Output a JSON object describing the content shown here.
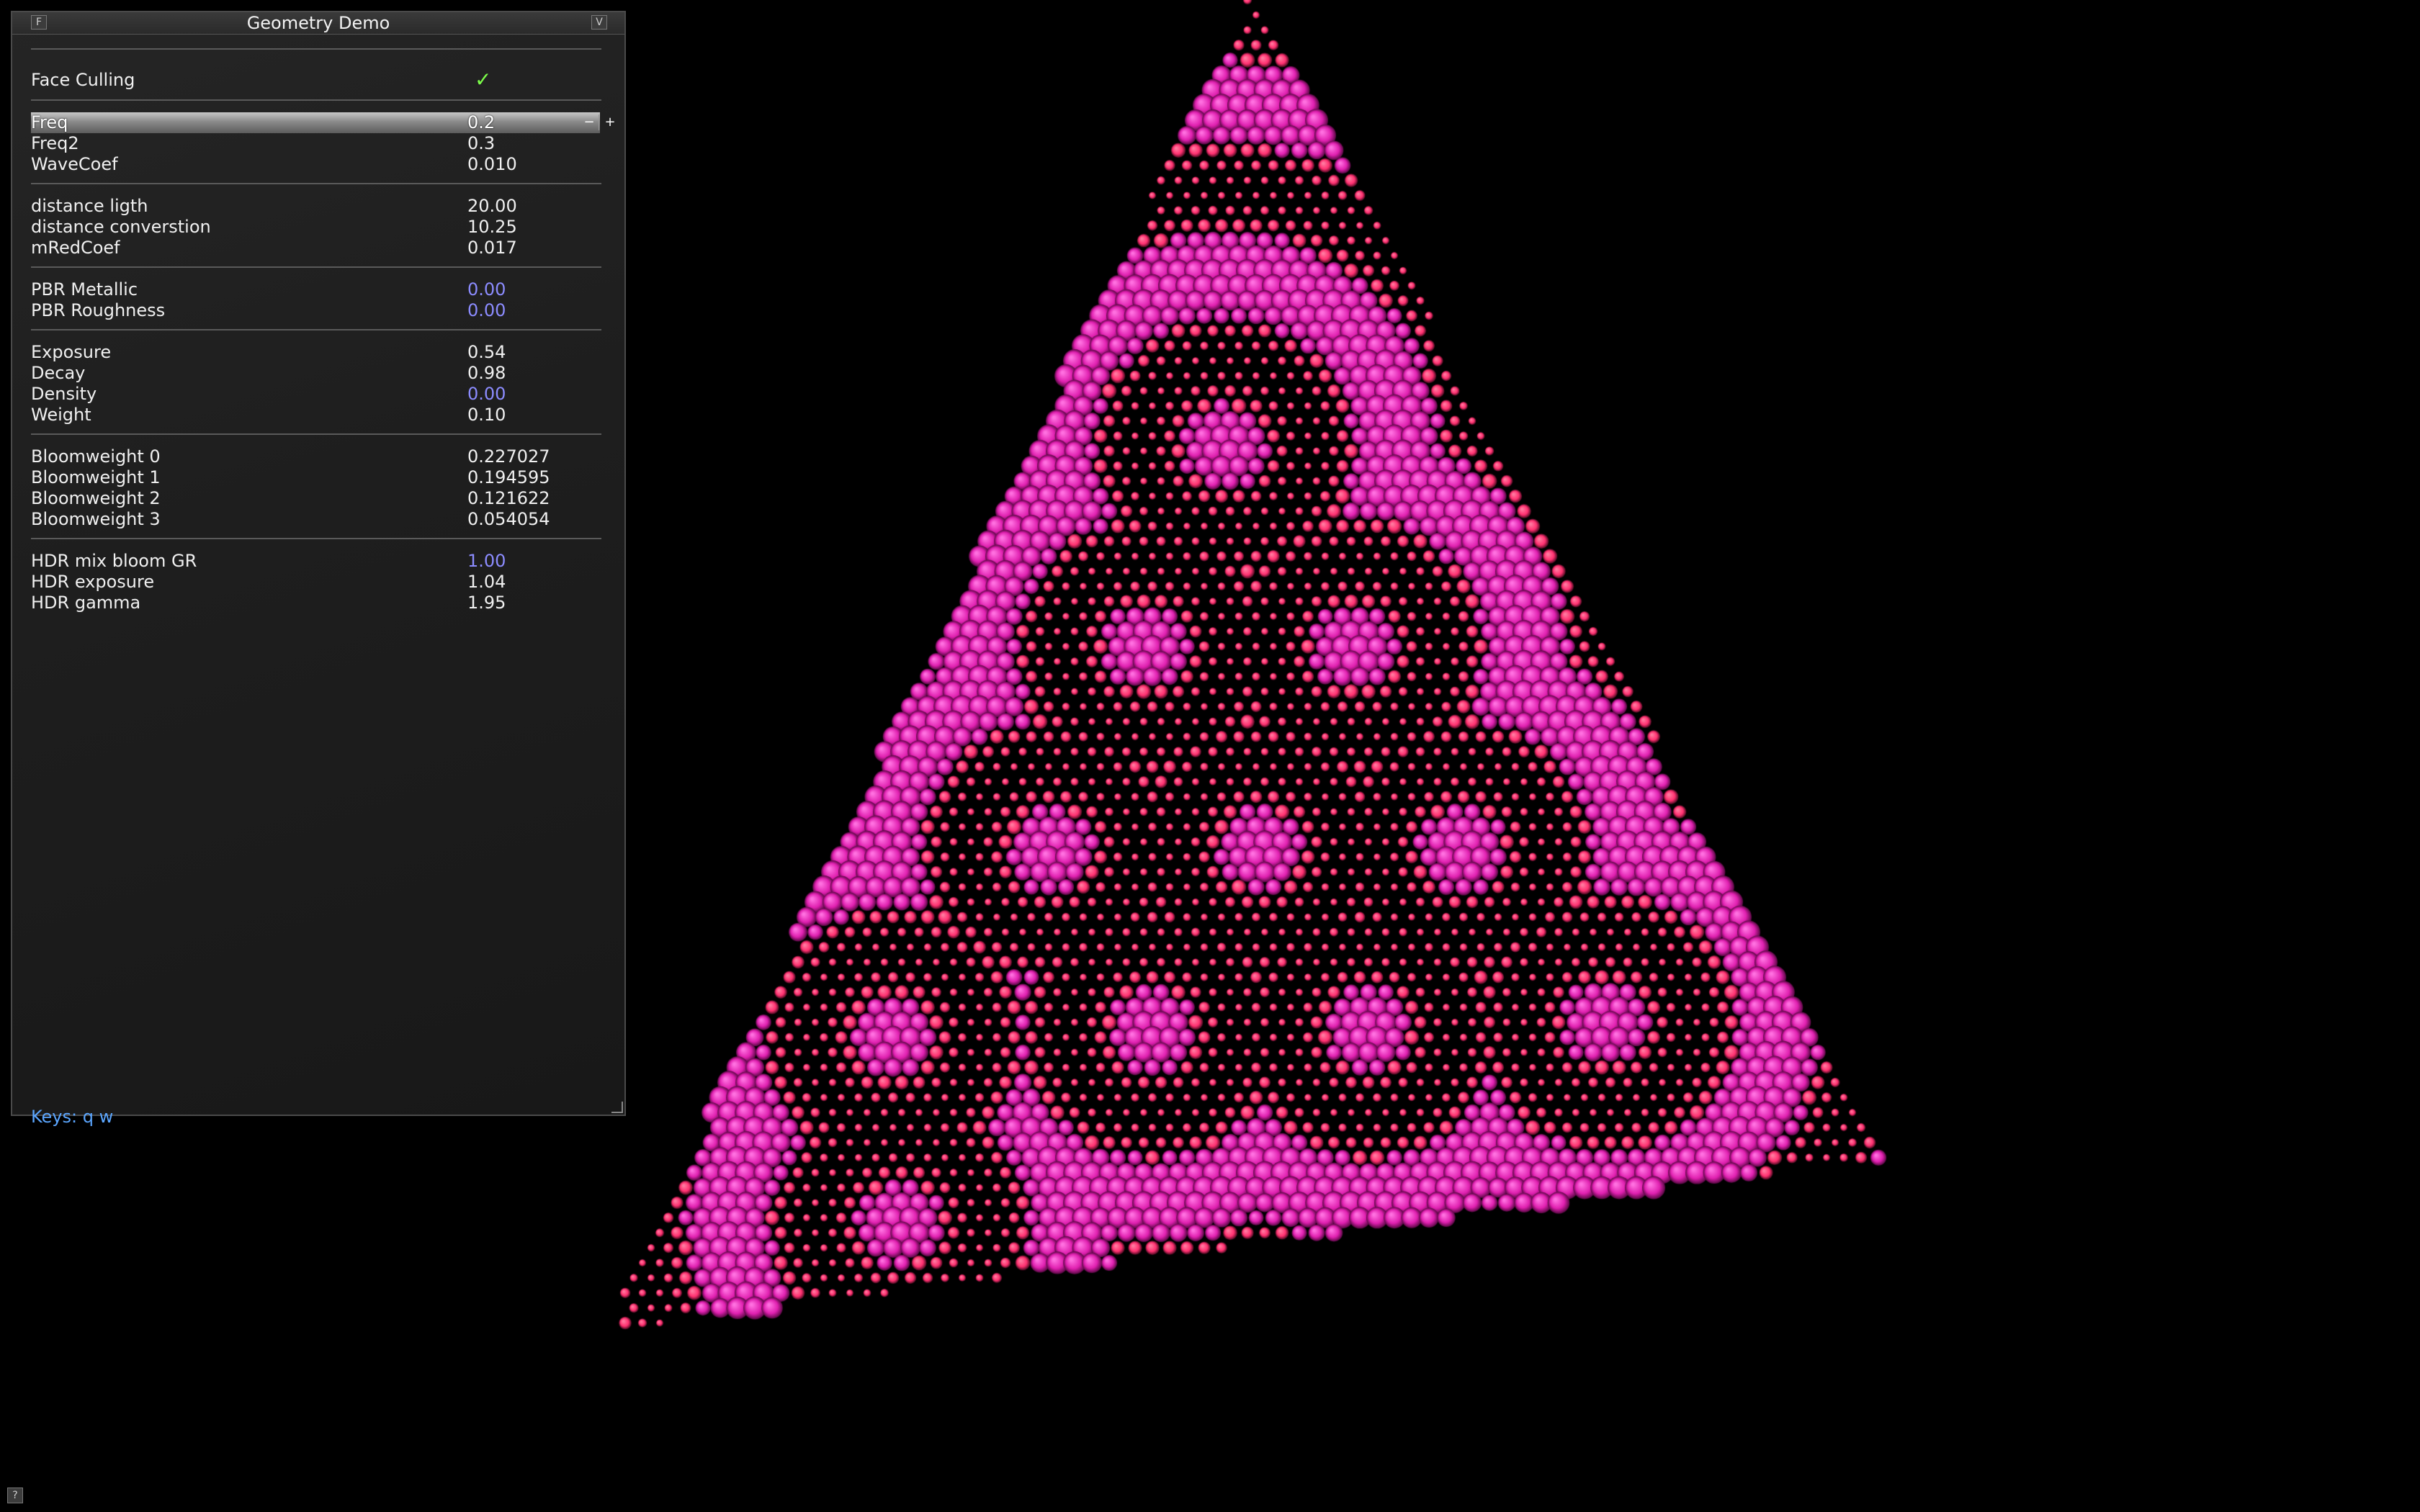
{
  "window": {
    "title": "Geometry Demo",
    "left_button_icon": "iconify-icon",
    "left_button_glyph": "F",
    "right_button_icon": "valign-icon",
    "right_button_glyph": "V"
  },
  "params": {
    "face_culling": {
      "label": "Face Culling",
      "checked": true
    },
    "freq": {
      "label": "Freq",
      "value": "0.2",
      "minus": "−",
      "plus": "+"
    },
    "freq2": {
      "label": "Freq2",
      "value": "0.3"
    },
    "wavecoef": {
      "label": "WaveCoef",
      "value": "0.010"
    },
    "distance_ligth": {
      "label": "distance ligth",
      "value": "20.00"
    },
    "distance_converstion": {
      "label": "distance converstion",
      "value": "10.25"
    },
    "mredcoef": {
      "label": "mRedCoef",
      "value": "0.017"
    },
    "pbr_metallic": {
      "label": "PBR Metallic",
      "value": "0.00"
    },
    "pbr_roughness": {
      "label": "PBR Roughness",
      "value": "0.00"
    },
    "exposure": {
      "label": "Exposure",
      "value": "0.54"
    },
    "decay": {
      "label": "Decay",
      "value": "0.98"
    },
    "density": {
      "label": "Density",
      "value": "0.00"
    },
    "weight": {
      "label": "Weight",
      "value": "0.10"
    },
    "bloomweight0": {
      "label": "Bloomweight 0",
      "value": "0.227027"
    },
    "bloomweight1": {
      "label": "Bloomweight 1",
      "value": "0.194595"
    },
    "bloomweight2": {
      "label": "Bloomweight 2",
      "value": "0.121622"
    },
    "bloomweight3": {
      "label": "Bloomweight 3",
      "value": "0.054054"
    },
    "hdr_mix_bloom_gr": {
      "label": "HDR mix bloom GR",
      "value": "1.00"
    },
    "hdr_exposure": {
      "label": "HDR exposure",
      "value": "1.04"
    },
    "hdr_gamma": {
      "label": "HDR gamma",
      "value": "1.95"
    }
  },
  "footer": {
    "keys_label": "Keys: q  w"
  },
  "global_help_glyph": "?",
  "colors": {
    "background": "#000000",
    "particle_magenta": "#e020b0",
    "particle_pink": "#ff3070",
    "particle_core": "#ff70e0",
    "check": "#7cff4a",
    "readonly_value": "#8c8cff",
    "help_text": "#5ba6ff"
  },
  "scene": {
    "description_object": "triangle-particle-field"
  }
}
